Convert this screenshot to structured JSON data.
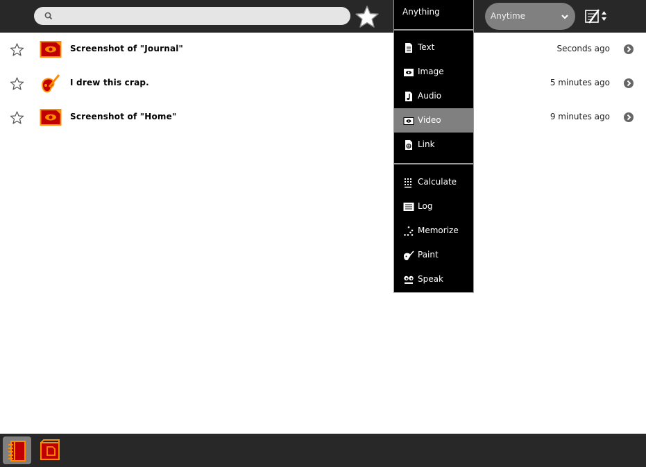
{
  "search": {
    "value": "",
    "placeholder": ""
  },
  "time_filter": {
    "selected": "Anytime"
  },
  "type_menu": {
    "header": "Anything",
    "groups": [
      [
        {
          "label": "Text",
          "icon": "text-doc-icon"
        },
        {
          "label": "Image",
          "icon": "image-icon"
        },
        {
          "label": "Audio",
          "icon": "audio-icon"
        },
        {
          "label": "Video",
          "icon": "video-icon",
          "selected": true
        },
        {
          "label": "Link",
          "icon": "link-icon"
        }
      ],
      [
        {
          "label": "Calculate",
          "icon": "calculate-icon"
        },
        {
          "label": "Log",
          "icon": "log-icon"
        },
        {
          "label": "Memorize",
          "icon": "memorize-icon"
        },
        {
          "label": "Paint",
          "icon": "paint-icon"
        },
        {
          "label": "Speak",
          "icon": "speak-icon"
        }
      ]
    ]
  },
  "entries": [
    {
      "title": "Screenshot of \"Journal\"",
      "time": "Seconds ago",
      "icon": "screenshot-icon"
    },
    {
      "title": "I drew this crap.",
      "time": "5 minutes ago",
      "icon": "paint-activity-icon"
    },
    {
      "title": "Screenshot of \"Home\"",
      "time": "9 minutes ago",
      "icon": "screenshot-icon"
    }
  ],
  "colors": {
    "toolbar": "#282828",
    "accent_orange": "#ff8c00",
    "accent_red": "#c00000",
    "menu_selected": "#808080"
  }
}
